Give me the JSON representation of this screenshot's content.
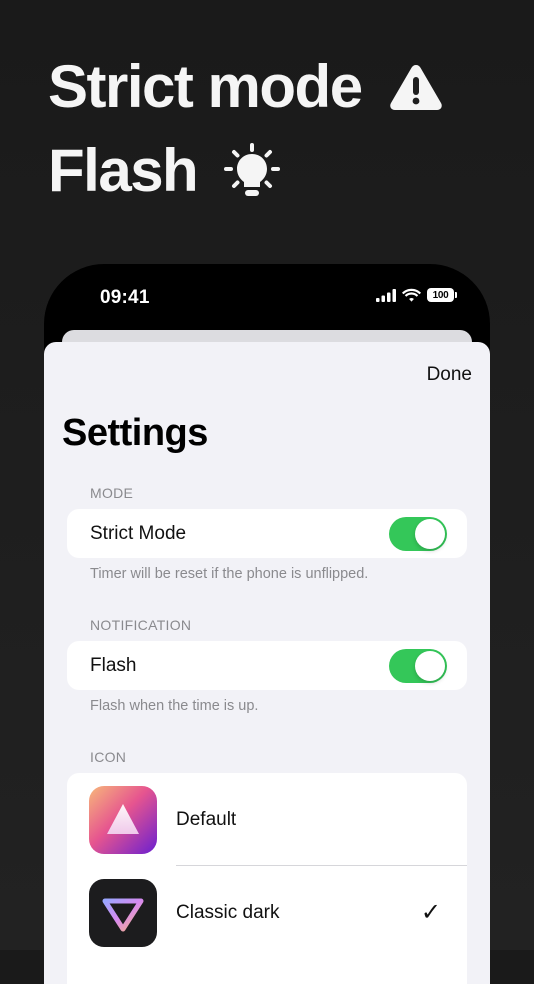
{
  "headline": {
    "line1": "Strict mode",
    "line1_icon": "warning-triangle-icon",
    "line2": "Flash",
    "line2_icon": "flashlight-icon"
  },
  "status_bar": {
    "time": "09:41",
    "battery": "100",
    "icons": [
      "signal-icon",
      "wifi-icon",
      "battery-icon"
    ]
  },
  "sheet": {
    "done_label": "Done",
    "title": "Settings",
    "sections": [
      {
        "header": "MODE",
        "row_label": "Strict Mode",
        "toggle_on": true,
        "footer": "Timer will be reset if the phone is unflipped."
      },
      {
        "header": "NOTIFICATION",
        "row_label": "Flash",
        "toggle_on": true,
        "footer": "Flash when the time is up."
      }
    ],
    "icon_section": {
      "header": "ICON",
      "items": [
        {
          "label": "Default",
          "icon": "gradient-triangle-icon",
          "selected": false
        },
        {
          "label": "Classic dark",
          "icon": "dark-triangle-icon",
          "selected": true,
          "check": "✓"
        }
      ]
    }
  },
  "colors": {
    "background": "#1e1e1e",
    "toggle_on": "#34c759",
    "sheet_bg": "#f2f2f7",
    "secondary_text": "#8a8a8e"
  }
}
